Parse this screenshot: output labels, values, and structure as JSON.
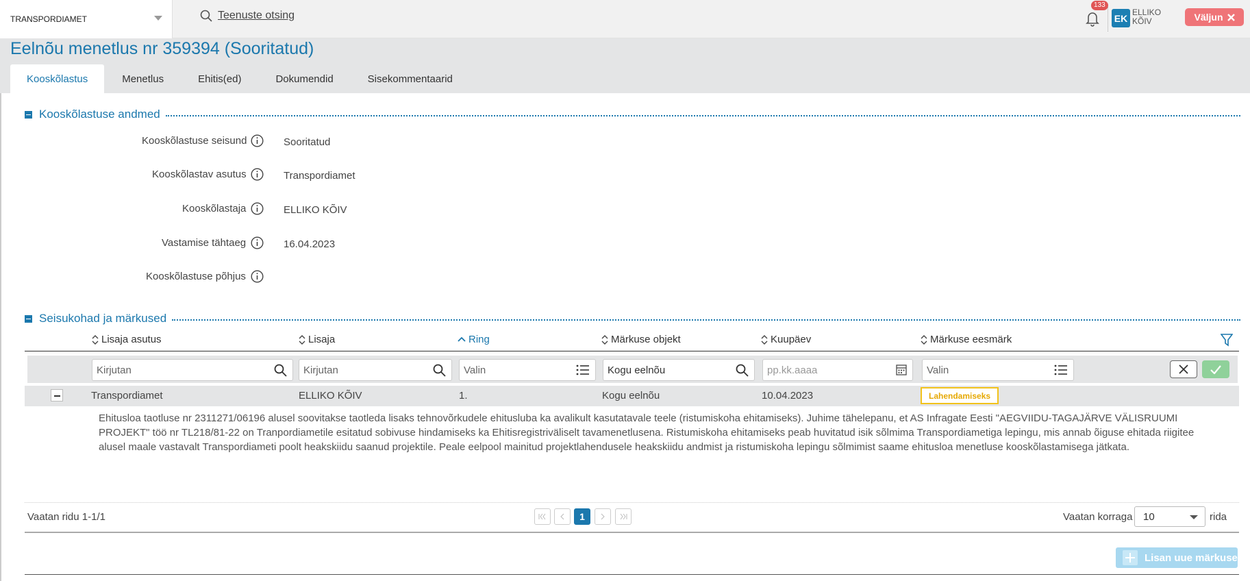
{
  "topbar": {
    "org": "TRANSPORDIAMET",
    "search_label": "Teenuste otsing",
    "notifications_count": "133",
    "user_initials": "EK",
    "user_name_line1": "ELLIKO",
    "user_name_line2": "KÕIV",
    "logout_label": "Väljun"
  },
  "page": {
    "title": "Eelnõu menetlus nr 359394 (Sooritatud)",
    "tabs": [
      "Kooskõlastus",
      "Menetlus",
      "Ehitis(ed)",
      "Dokumendid",
      "Sisekommentaarid"
    ]
  },
  "section1": {
    "title": "Kooskõlastuse andmed",
    "fields": [
      {
        "label": "Kooskõlastuse seisund",
        "value": "Sooritatud"
      },
      {
        "label": "Kooskõlastav asutus",
        "value": "Transpordiamet"
      },
      {
        "label": "Kooskõlastaja",
        "value": "ELLIKO KÕIV"
      },
      {
        "label": "Vastamise tähtaeg",
        "value": "16.04.2023"
      },
      {
        "label": "Kooskõlastuse põhjus",
        "value": ""
      }
    ]
  },
  "section2": {
    "title": "Seisukohad ja märkused",
    "columns": [
      "Lisaja asutus",
      "Lisaja",
      "Ring",
      "Märkuse objekt",
      "Kuupäev",
      "Märkuse eesmärk"
    ],
    "filters": {
      "asutus": "Kirjutan",
      "lisaja": "Kirjutan",
      "ring": "Valin",
      "objekt": "Kogu eelnõu",
      "kuupaev_placeholder": "pp.kk.aaaa",
      "eesmark": "Valin"
    },
    "row": {
      "asutus": "Transpordiamet",
      "lisaja": "ELLIKO KÕIV",
      "ring": "1.",
      "objekt": "Kogu eelnõu",
      "kuupaev": "10.04.2023",
      "eesmark": "Lahendamiseks",
      "comment": "Ehitusloa taotluse nr 2311271/06196 alusel soovitakse taotleda lisaks tehnovõrkudele ehitusluba ka avalikult kasutatavale teele (ristumiskoha ehitamiseks). Juhime tähelepanu, et AS Infragate Eesti \"AEGVIIDU-TAGAJÄRVE VÄLISRUUMI PROJEKT\" töö nr TL218/81-22 on Tranpordiametile esitatud sobivuse hindamiseks ka Ehitisregistriväliselt tavamenetlusena. Ristumiskoha ehitamiseks peab huvitatud isik sõlmima Transpordiametiga lepingu, mis annab õiguse ehitada riigitee alusel maale vastavalt Transpordiameti poolt heakskiidu saanud projektile. Peale eelpool mainitud projektlahendusele heakskiidu andmist ja ristumiskoha lepingu sõlmimist saame ehitusloa menetluse kooskõlastamisega jätkata."
    },
    "pager": {
      "info": "Vaatan ridu 1-1/1",
      "current_page": "1",
      "per_page_label": "Vaatan korraga",
      "per_page_value": "10",
      "per_page_suffix": "rida"
    },
    "add_label": "Lisan uue märkuse"
  },
  "colors": {
    "accent": "#1b78ad",
    "badge": "#f2c21b",
    "logout": "#ef7478"
  }
}
